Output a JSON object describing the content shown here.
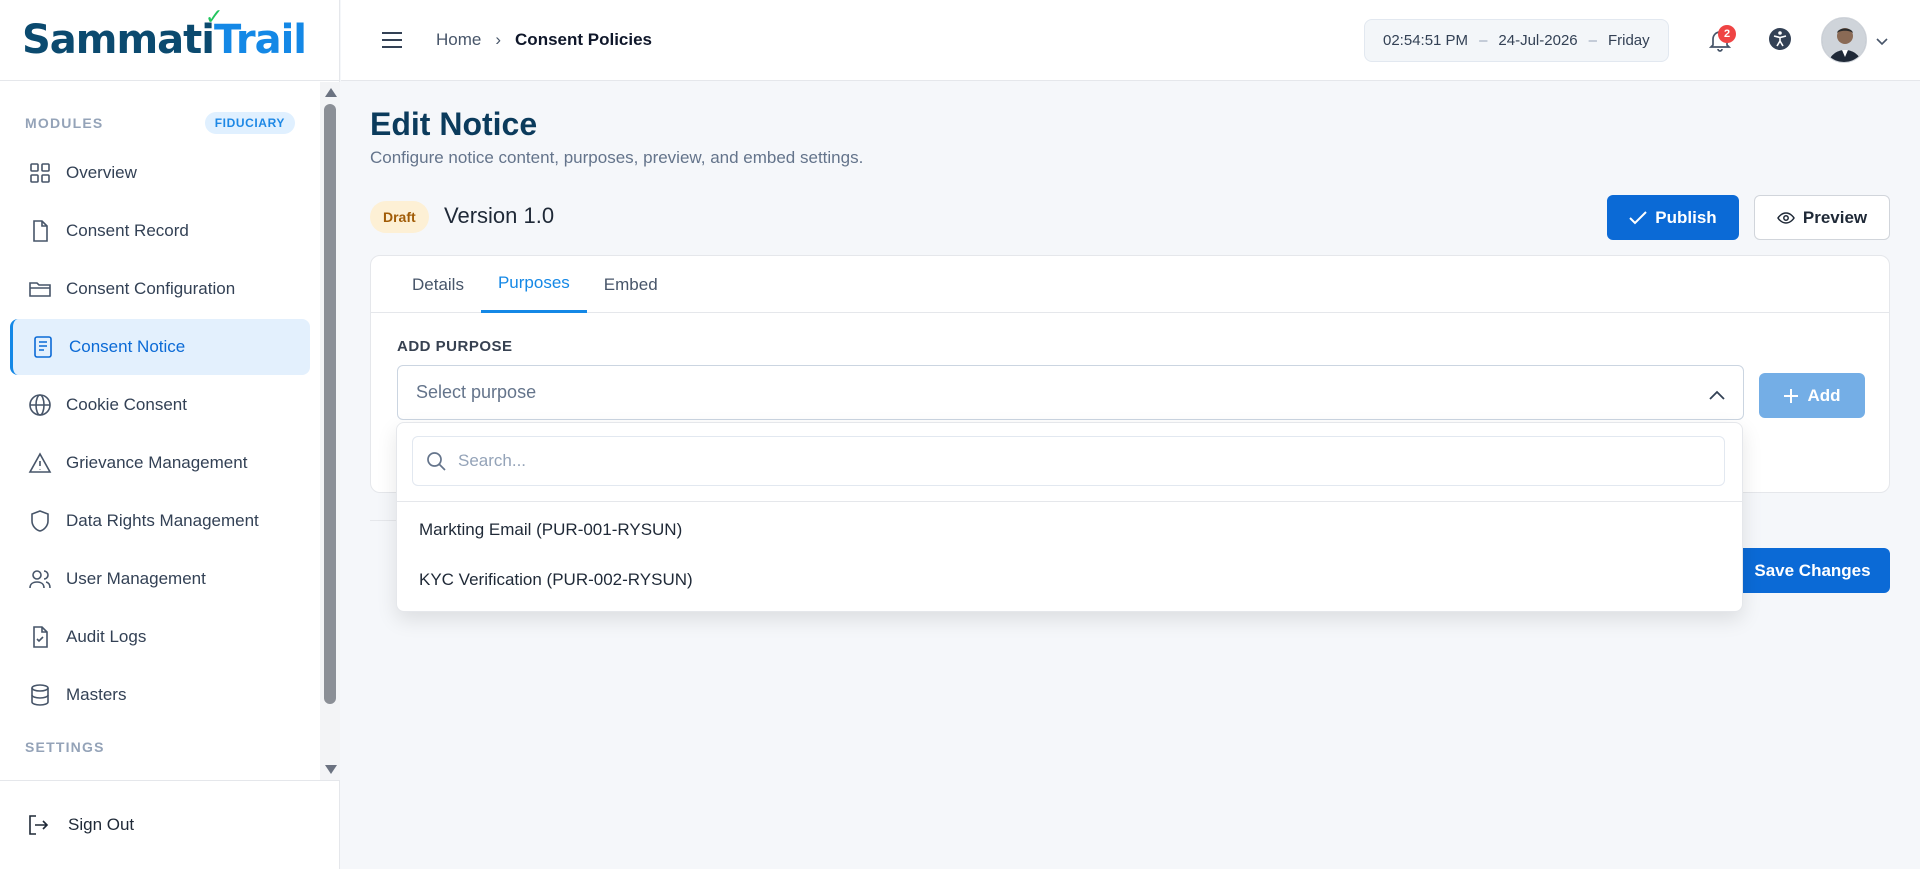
{
  "app": {
    "logo_part1": "Sammati",
    "logo_part2": "Trail"
  },
  "sidebar": {
    "modules_label": "MODULES",
    "role_badge": "FIDUCIARY",
    "items": [
      {
        "label": "Overview",
        "icon": "grid-icon"
      },
      {
        "label": "Consent Record",
        "icon": "file-icon"
      },
      {
        "label": "Consent Configuration",
        "icon": "folder-icon"
      },
      {
        "label": "Consent Notice",
        "icon": "notice-icon",
        "active": true
      },
      {
        "label": "Cookie Consent",
        "icon": "globe-icon"
      },
      {
        "label": "Grievance Management",
        "icon": "warning-icon"
      },
      {
        "label": "Data Rights Management",
        "icon": "shield-icon"
      },
      {
        "label": "User Management",
        "icon": "users-icon"
      },
      {
        "label": "Audit Logs",
        "icon": "file-check-icon"
      },
      {
        "label": "Masters",
        "icon": "database-icon"
      }
    ],
    "settings_label": "SETTINGS",
    "signout_label": "Sign Out"
  },
  "header": {
    "breadcrumb_home": "Home",
    "breadcrumb_current": "Consent Policies",
    "time": "02:54:51 PM",
    "date": "24-Jul-2026",
    "day": "Friday",
    "notification_count": "2"
  },
  "page": {
    "title": "Edit Notice",
    "subtitle": "Configure notice content, purposes, preview, and embed settings.",
    "status_badge": "Draft",
    "version": "Version 1.0",
    "publish_label": "Publish",
    "preview_label": "Preview",
    "save_label": "Save Changes"
  },
  "tabs": [
    {
      "label": "Details"
    },
    {
      "label": "Purposes",
      "active": true
    },
    {
      "label": "Embed"
    }
  ],
  "purpose_form": {
    "field_label": "ADD PURPOSE",
    "select_placeholder": "Select purpose",
    "add_label": "Add",
    "search_placeholder": "Search...",
    "options": [
      "Markting Email (PUR-001-RYSUN)",
      "KYC Verification (PUR-002-RYSUN)"
    ]
  },
  "colors": {
    "primary": "#0b6ad6",
    "accent": "#1488e6",
    "title": "#0b3b5c",
    "draft_bg": "#fdf0d5",
    "draft_text": "#a15c07",
    "badge_red": "#ef4444"
  }
}
